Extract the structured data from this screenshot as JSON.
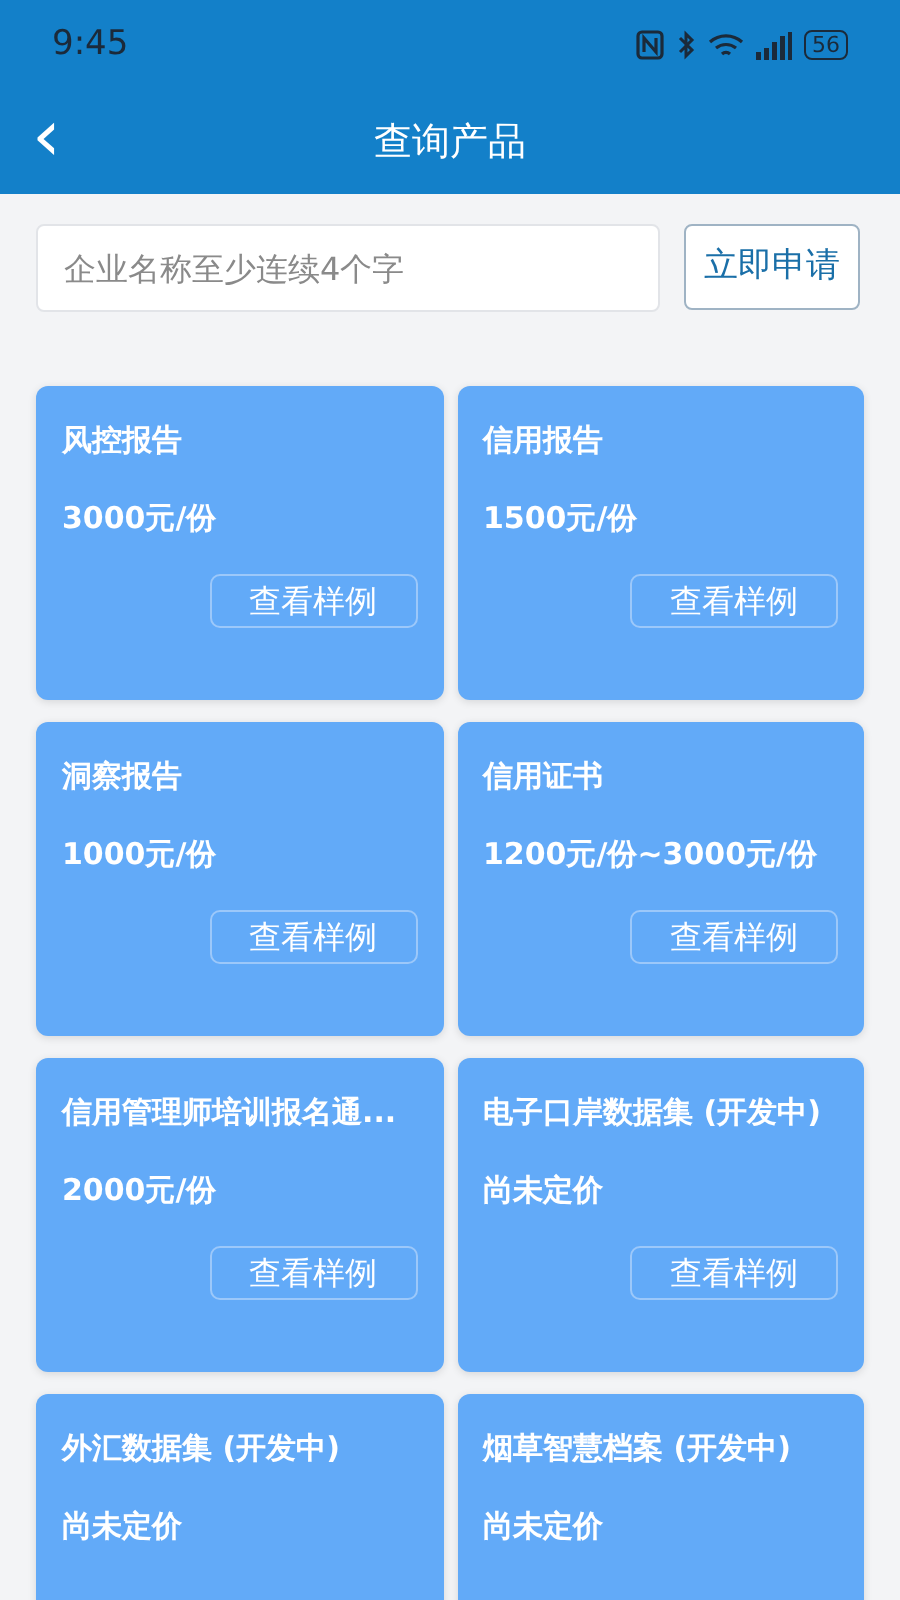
{
  "status_bar": {
    "time": "9:45",
    "battery": "56"
  },
  "header": {
    "back": "‹",
    "title": "查询产品"
  },
  "search": {
    "placeholder": "企业名称至少连续4个字",
    "button": "立即申请"
  },
  "cards": [
    {
      "title": "风控报告",
      "price": "3000元/份",
      "sample_button": "查看样例"
    },
    {
      "title": "信用报告",
      "price": "1500元/份",
      "sample_button": "查看样例"
    },
    {
      "title": "洞察报告",
      "price": "1000元/份",
      "sample_button": "查看样例"
    },
    {
      "title": "信用证书",
      "price": "1200元/份~3000元/份",
      "sample_button": "查看样例"
    },
    {
      "title": "信用管理师培训报名通...",
      "price": "2000元/份",
      "sample_button": "查看样例"
    },
    {
      "title": "电子口岸数据集 (开发中)",
      "price": "尚未定价",
      "sample_button": "查看样例"
    },
    {
      "title": "外汇数据集 (开发中)",
      "price": "尚未定价"
    },
    {
      "title": "烟草智慧档案 (开发中)",
      "price": "尚未定价"
    }
  ]
}
